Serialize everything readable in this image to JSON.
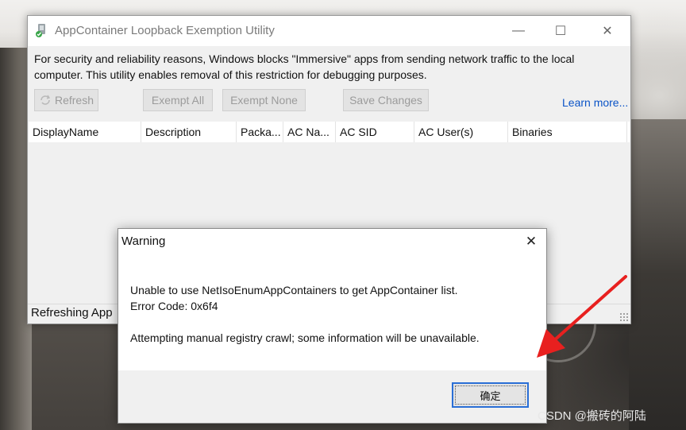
{
  "window": {
    "title": "AppContainer Loopback Exemption Utility",
    "description": "For security and reliability reasons, Windows blocks \"Immersive\" apps from sending network traffic to the local computer. This utility enables removal of this restriction for debugging purposes.",
    "minimize_glyph": "—",
    "maximize_glyph": "☐",
    "close_glyph": "✕"
  },
  "toolbar": {
    "refresh_label": "Refresh",
    "exempt_all_label": "Exempt All",
    "exempt_none_label": "Exempt None",
    "save_label": "Save Changes",
    "learn_more_label": "Learn more..."
  },
  "list": {
    "columns": [
      "DisplayName",
      "Description",
      "Packa...",
      "AC Na...",
      "AC SID",
      "AC User(s)",
      "Binaries"
    ]
  },
  "status": {
    "text": "Refreshing App"
  },
  "dialog": {
    "title": "Warning",
    "close_glyph": "✕",
    "line1": "Unable to use NetIsoEnumAppContainers to get AppContainer list.",
    "line2": "Error Code: 0x6f4",
    "line3": "Attempting manual registry crawl; some information will be unavailable.",
    "ok_label": "确定"
  },
  "watermark": "CSDN @搬砖的阿陆",
  "colors": {
    "link": "#0b54c7",
    "arrow": "#e8201f",
    "focus": "#2a6fd6"
  },
  "icons": [
    "app-icon",
    "refresh-icon",
    "close-icon",
    "minimize-icon",
    "maximize-icon",
    "red-arrow"
  ]
}
